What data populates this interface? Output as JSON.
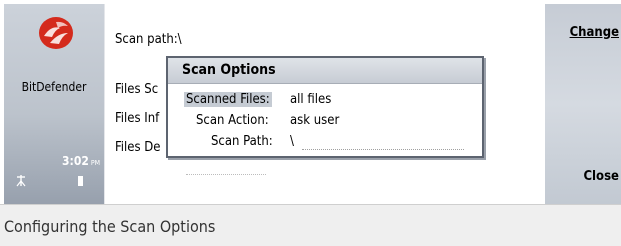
{
  "app": {
    "name": "BitDefender",
    "time": "3:02",
    "ampm": "PM"
  },
  "main": {
    "scan_path_line": "Scan path:\\",
    "line_files_scanned": "Files Sc",
    "line_files_infected": "Files Inf",
    "line_files_deleted": "Files De"
  },
  "softkeys": {
    "top": "Change",
    "bottom": "Close"
  },
  "popup": {
    "title": "Scan Options",
    "options": [
      {
        "label": "Scanned Files:",
        "value": "all files",
        "selected": true
      },
      {
        "label": "Scan Action:",
        "value": "ask user",
        "selected": false
      },
      {
        "label": "Scan Path:",
        "value": "\\",
        "selected": false
      }
    ]
  },
  "caption": "Configuring the Scan Options",
  "colors": {
    "logo_red": "#d42a1c",
    "selection": "#c5cbd3"
  }
}
